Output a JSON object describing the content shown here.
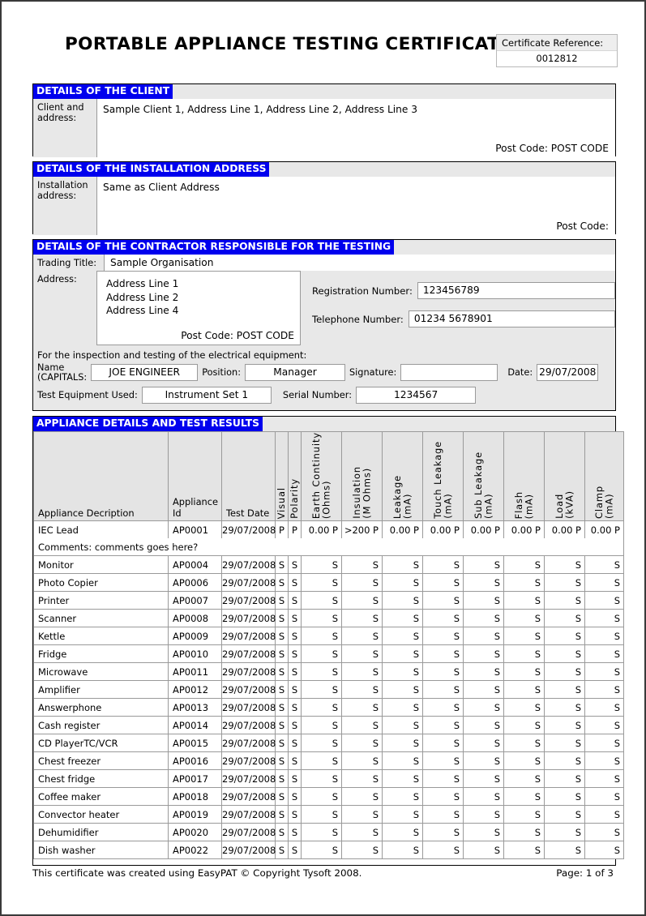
{
  "document": {
    "title": "PORTABLE APPLIANCE TESTING CERTIFICATE"
  },
  "certificate_reference": {
    "label": "Certificate Reference:",
    "value": "0012812"
  },
  "client_section": {
    "heading": "DETAILS OF THE CLIENT",
    "label": "Client and address:",
    "address": "Sample Client 1, Address Line 1, Address Line 2, Address Line 3",
    "postcode": "Post Code: POST CODE"
  },
  "installation_section": {
    "heading": "DETAILS OF THE INSTALLATION ADDRESS",
    "label": "Installation address:",
    "address": "Same as Client Address",
    "postcode": "Post Code:"
  },
  "contractor_section": {
    "heading": "DETAILS OF THE CONTRACTOR RESPONSIBLE FOR THE TESTING",
    "trading_title_label": "Trading Title:",
    "trading_title_value": "Sample Organisation",
    "address_label": "Address:",
    "address_line_1": "Address Line 1",
    "address_line_2": "Address Line 2",
    "address_line_3": "Address Line 4",
    "address_postcode": "Post Code: POST CODE",
    "registration_label": "Registration Number:",
    "registration_value": "123456789",
    "telephone_label": "Telephone Number:",
    "telephone_value": "01234 5678901",
    "inspection_note": "For the inspection and testing of the electrical equipment:",
    "name_label": "Name (CAPITALS:",
    "name_label_line1": "Name",
    "name_label_line2": "(CAPITALS:",
    "name_value": "JOE ENGINEER",
    "position_label": "Position:",
    "position_value": "Manager",
    "signature_label": "Signature:",
    "signature_value": "",
    "date_label": "Date:",
    "date_value": "29/07/2008",
    "test_equipment_label": "Test Equipment Used:",
    "test_equipment_value": "Instrument Set 1",
    "serial_label": "Serial Number:",
    "serial_value": "1234567"
  },
  "results_section": {
    "heading": "APPLIANCE DETAILS AND TEST RESULTS",
    "columns": [
      {
        "label": "Appliance Decription",
        "orientation": "horizontal"
      },
      {
        "label": "Appliance Id",
        "orientation": "horizontal"
      },
      {
        "label": "Test Date",
        "orientation": "horizontal"
      },
      {
        "label": "Visual",
        "orientation": "vertical"
      },
      {
        "label": "Polarity",
        "orientation": "vertical"
      },
      {
        "label": "Earth Continuity\n(Ohms)",
        "orientation": "vertical"
      },
      {
        "label": "Insulation\n(M Ohms)",
        "orientation": "vertical"
      },
      {
        "label": "Leakage\n(mA)",
        "orientation": "vertical"
      },
      {
        "label": "Touch Leakage\n(mA)",
        "orientation": "vertical"
      },
      {
        "label": "Sub Leakage\n(mA)",
        "orientation": "vertical"
      },
      {
        "label": "Flash\n(mA)",
        "orientation": "vertical"
      },
      {
        "label": "Load\n(kVA)",
        "orientation": "vertical"
      },
      {
        "label": "Clamp\n(mA)",
        "orientation": "vertical"
      }
    ],
    "rows": [
      {
        "description": "IEC Lead",
        "appliance_id": "AP0001",
        "test_date": "29/07/2008",
        "visual": "P",
        "polarity": "P",
        "earth_continuity": "0.00 P",
        "insulation": ">200 P",
        "leakage": "0.00 P",
        "touch_leakage": "0.00 P",
        "sub_leakage": "0.00 P",
        "flash": "0.00 P",
        "load": "0.00 P",
        "clamp": "0.00 P",
        "comments": "Comments: comments goes here?"
      },
      {
        "description": "Monitor",
        "appliance_id": "AP0004",
        "test_date": "29/07/2008",
        "visual": "S",
        "polarity": "S",
        "earth_continuity": "S",
        "insulation": "S",
        "leakage": "S",
        "touch_leakage": "S",
        "sub_leakage": "S",
        "flash": "S",
        "load": "S",
        "clamp": "S",
        "comments": ""
      },
      {
        "description": "Photo Copier",
        "appliance_id": "AP0006",
        "test_date": "29/07/2008",
        "visual": "S",
        "polarity": "S",
        "earth_continuity": "S",
        "insulation": "S",
        "leakage": "S",
        "touch_leakage": "S",
        "sub_leakage": "S",
        "flash": "S",
        "load": "S",
        "clamp": "S",
        "comments": ""
      },
      {
        "description": "Printer",
        "appliance_id": "AP0007",
        "test_date": "29/07/2008",
        "visual": "S",
        "polarity": "S",
        "earth_continuity": "S",
        "insulation": "S",
        "leakage": "S",
        "touch_leakage": "S",
        "sub_leakage": "S",
        "flash": "S",
        "load": "S",
        "clamp": "S",
        "comments": ""
      },
      {
        "description": "Scanner",
        "appliance_id": "AP0008",
        "test_date": "29/07/2008",
        "visual": "S",
        "polarity": "S",
        "earth_continuity": "S",
        "insulation": "S",
        "leakage": "S",
        "touch_leakage": "S",
        "sub_leakage": "S",
        "flash": "S",
        "load": "S",
        "clamp": "S",
        "comments": ""
      },
      {
        "description": "Kettle",
        "appliance_id": "AP0009",
        "test_date": "29/07/2008",
        "visual": "S",
        "polarity": "S",
        "earth_continuity": "S",
        "insulation": "S",
        "leakage": "S",
        "touch_leakage": "S",
        "sub_leakage": "S",
        "flash": "S",
        "load": "S",
        "clamp": "S",
        "comments": ""
      },
      {
        "description": "Fridge",
        "appliance_id": "AP0010",
        "test_date": "29/07/2008",
        "visual": "S",
        "polarity": "S",
        "earth_continuity": "S",
        "insulation": "S",
        "leakage": "S",
        "touch_leakage": "S",
        "sub_leakage": "S",
        "flash": "S",
        "load": "S",
        "clamp": "S",
        "comments": ""
      },
      {
        "description": "Microwave",
        "appliance_id": "AP0011",
        "test_date": "29/07/2008",
        "visual": "S",
        "polarity": "S",
        "earth_continuity": "S",
        "insulation": "S",
        "leakage": "S",
        "touch_leakage": "S",
        "sub_leakage": "S",
        "flash": "S",
        "load": "S",
        "clamp": "S",
        "comments": ""
      },
      {
        "description": "Amplifier",
        "appliance_id": "AP0012",
        "test_date": "29/07/2008",
        "visual": "S",
        "polarity": "S",
        "earth_continuity": "S",
        "insulation": "S",
        "leakage": "S",
        "touch_leakage": "S",
        "sub_leakage": "S",
        "flash": "S",
        "load": "S",
        "clamp": "S",
        "comments": ""
      },
      {
        "description": "Answerphone",
        "appliance_id": "AP0013",
        "test_date": "29/07/2008",
        "visual": "S",
        "polarity": "S",
        "earth_continuity": "S",
        "insulation": "S",
        "leakage": "S",
        "touch_leakage": "S",
        "sub_leakage": "S",
        "flash": "S",
        "load": "S",
        "clamp": "S",
        "comments": ""
      },
      {
        "description": "Cash register",
        "appliance_id": "AP0014",
        "test_date": "29/07/2008",
        "visual": "S",
        "polarity": "S",
        "earth_continuity": "S",
        "insulation": "S",
        "leakage": "S",
        "touch_leakage": "S",
        "sub_leakage": "S",
        "flash": "S",
        "load": "S",
        "clamp": "S",
        "comments": ""
      },
      {
        "description": "CD PlayerTC/VCR",
        "appliance_id": "AP0015",
        "test_date": "29/07/2008",
        "visual": "S",
        "polarity": "S",
        "earth_continuity": "S",
        "insulation": "S",
        "leakage": "S",
        "touch_leakage": "S",
        "sub_leakage": "S",
        "flash": "S",
        "load": "S",
        "clamp": "S",
        "comments": ""
      },
      {
        "description": "Chest freezer",
        "appliance_id": "AP0016",
        "test_date": "29/07/2008",
        "visual": "S",
        "polarity": "S",
        "earth_continuity": "S",
        "insulation": "S",
        "leakage": "S",
        "touch_leakage": "S",
        "sub_leakage": "S",
        "flash": "S",
        "load": "S",
        "clamp": "S",
        "comments": ""
      },
      {
        "description": "Chest fridge",
        "appliance_id": "AP0017",
        "test_date": "29/07/2008",
        "visual": "S",
        "polarity": "S",
        "earth_continuity": "S",
        "insulation": "S",
        "leakage": "S",
        "touch_leakage": "S",
        "sub_leakage": "S",
        "flash": "S",
        "load": "S",
        "clamp": "S",
        "comments": ""
      },
      {
        "description": "Coffee maker",
        "appliance_id": "AP0018",
        "test_date": "29/07/2008",
        "visual": "S",
        "polarity": "S",
        "earth_continuity": "S",
        "insulation": "S",
        "leakage": "S",
        "touch_leakage": "S",
        "sub_leakage": "S",
        "flash": "S",
        "load": "S",
        "clamp": "S",
        "comments": ""
      },
      {
        "description": "Convector heater",
        "appliance_id": "AP0019",
        "test_date": "29/07/2008",
        "visual": "S",
        "polarity": "S",
        "earth_continuity": "S",
        "insulation": "S",
        "leakage": "S",
        "touch_leakage": "S",
        "sub_leakage": "S",
        "flash": "S",
        "load": "S",
        "clamp": "S",
        "comments": ""
      },
      {
        "description": "Dehumidifier",
        "appliance_id": "AP0020",
        "test_date": "29/07/2008",
        "visual": "S",
        "polarity": "S",
        "earth_continuity": "S",
        "insulation": "S",
        "leakage": "S",
        "touch_leakage": "S",
        "sub_leakage": "S",
        "flash": "S",
        "load": "S",
        "clamp": "S",
        "comments": ""
      },
      {
        "description": "Dish washer",
        "appliance_id": "AP0022",
        "test_date": "29/07/2008",
        "visual": "S",
        "polarity": "S",
        "earth_continuity": "S",
        "insulation": "S",
        "leakage": "S",
        "touch_leakage": "S",
        "sub_leakage": "S",
        "flash": "S",
        "load": "S",
        "clamp": "S",
        "comments": ""
      }
    ]
  },
  "footer": {
    "left": "This certificate was created using EasyPAT © Copyright Tysoft 2008.",
    "right": "Page: 1 of 3"
  },
  "colors": {
    "heading_bar": "#0000ee",
    "heading_text": "#ffffff",
    "panel_background": "#e8e8e8",
    "field_background": "#ffffff",
    "border": "#000000"
  }
}
